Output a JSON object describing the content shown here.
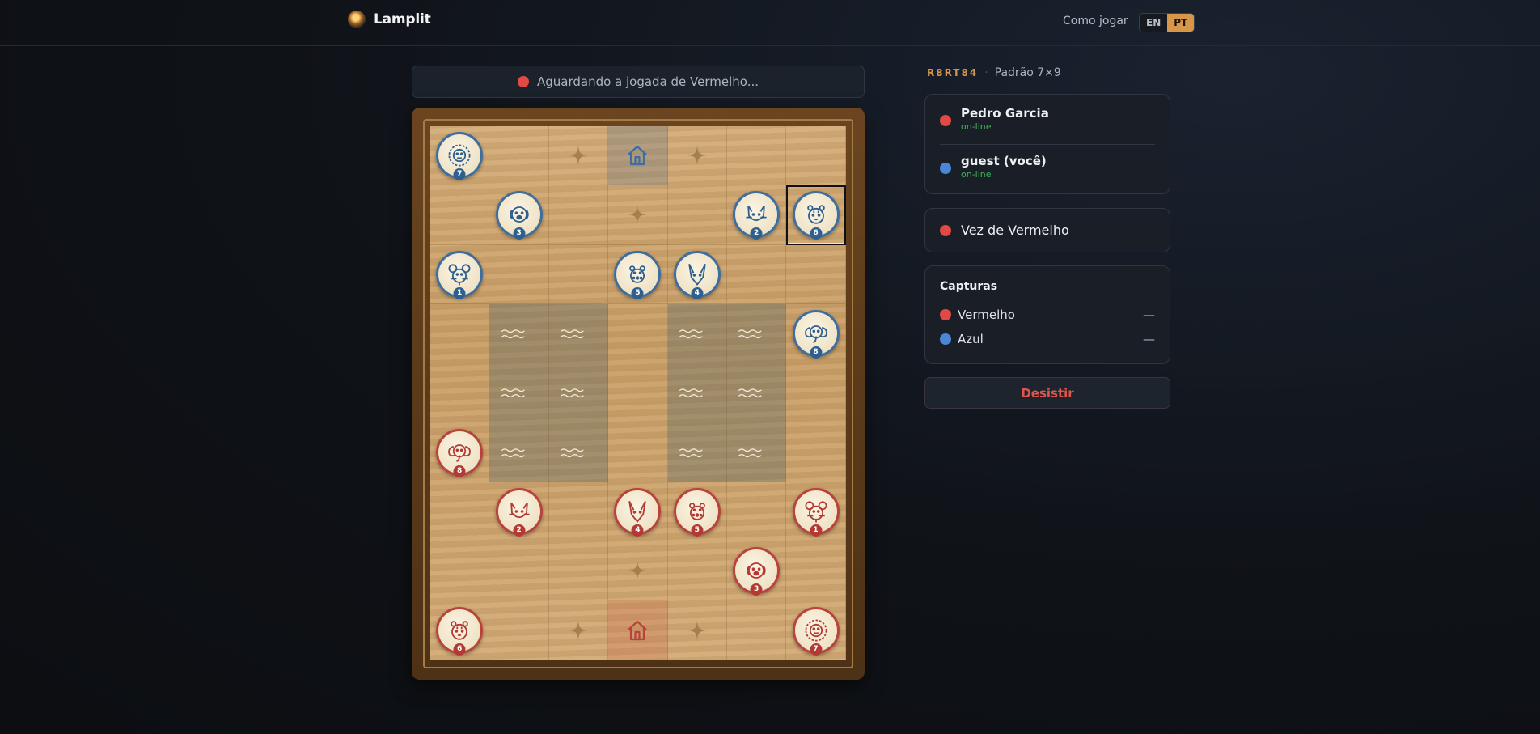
{
  "header": {
    "brand": "Lamplit",
    "how_to_play": "Como jogar",
    "lang_en": "EN",
    "lang_pt": "PT",
    "lang_selected": "PT"
  },
  "status": {
    "text": "Aguardando a jogada de Vermelho..."
  },
  "game": {
    "code": "R8RT84",
    "separator": "·",
    "mode": "Padrão 7×9"
  },
  "players": [
    {
      "name": "Pedro Garcia",
      "status": "on-line",
      "color": "red"
    },
    {
      "name": "guest (você)",
      "status": "on-line",
      "color": "blue"
    }
  ],
  "turn": {
    "text": "Vez de Vermelho"
  },
  "captures": {
    "title": "Capturas",
    "rows": [
      {
        "label": "Vermelho",
        "value": "—",
        "color": "red"
      },
      {
        "label": "Azul",
        "value": "—",
        "color": "blue"
      }
    ]
  },
  "resign_label": "Desistir",
  "colors": {
    "accent": "#d7974a",
    "red": "#e04a44",
    "blue": "#4b87d6",
    "online": "#3fb356"
  },
  "board": {
    "cols": 7,
    "rows": 9,
    "pieces": [
      {
        "side": "blue",
        "animal": "lion",
        "rank": "7",
        "row": 0,
        "col": 0
      },
      {
        "side": "blue",
        "animal": "dog",
        "rank": "3",
        "row": 1,
        "col": 1
      },
      {
        "side": "blue",
        "animal": "cat",
        "rank": "2",
        "row": 1,
        "col": 5
      },
      {
        "side": "blue",
        "animal": "tiger",
        "rank": "6",
        "row": 1,
        "col": 6,
        "selected": true
      },
      {
        "side": "blue",
        "animal": "rat",
        "rank": "1",
        "row": 2,
        "col": 0
      },
      {
        "side": "blue",
        "animal": "leopard",
        "rank": "5",
        "row": 2,
        "col": 3
      },
      {
        "side": "blue",
        "animal": "wolf",
        "rank": "4",
        "row": 2,
        "col": 4
      },
      {
        "side": "blue",
        "animal": "elephant",
        "rank": "8",
        "row": 3,
        "col": 6
      },
      {
        "side": "red",
        "animal": "elephant",
        "rank": "8",
        "row": 5,
        "col": 0
      },
      {
        "side": "red",
        "animal": "cat",
        "rank": "2",
        "row": 6,
        "col": 1
      },
      {
        "side": "red",
        "animal": "wolf",
        "rank": "4",
        "row": 6,
        "col": 3
      },
      {
        "side": "red",
        "animal": "leopard",
        "rank": "5",
        "row": 6,
        "col": 4
      },
      {
        "side": "red",
        "animal": "rat",
        "rank": "1",
        "row": 6,
        "col": 6
      },
      {
        "side": "red",
        "animal": "dog",
        "rank": "3",
        "row": 7,
        "col": 5
      },
      {
        "side": "red",
        "animal": "tiger",
        "rank": "6",
        "row": 8,
        "col": 0
      },
      {
        "side": "red",
        "animal": "lion",
        "rank": "7",
        "row": 8,
        "col": 6
      }
    ],
    "water": [
      [
        3,
        1
      ],
      [
        3,
        2
      ],
      [
        3,
        4
      ],
      [
        3,
        5
      ],
      [
        4,
        1
      ],
      [
        4,
        2
      ],
      [
        4,
        4
      ],
      [
        4,
        5
      ],
      [
        5,
        1
      ],
      [
        5,
        2
      ],
      [
        5,
        4
      ],
      [
        5,
        5
      ]
    ],
    "traps": [
      [
        0,
        2
      ],
      [
        0,
        4
      ],
      [
        1,
        3
      ],
      [
        7,
        3
      ],
      [
        8,
        2
      ],
      [
        8,
        4
      ]
    ],
    "dens": [
      {
        "row": 0,
        "col": 3,
        "side": "blue"
      },
      {
        "row": 8,
        "col": 3,
        "side": "red"
      }
    ]
  }
}
